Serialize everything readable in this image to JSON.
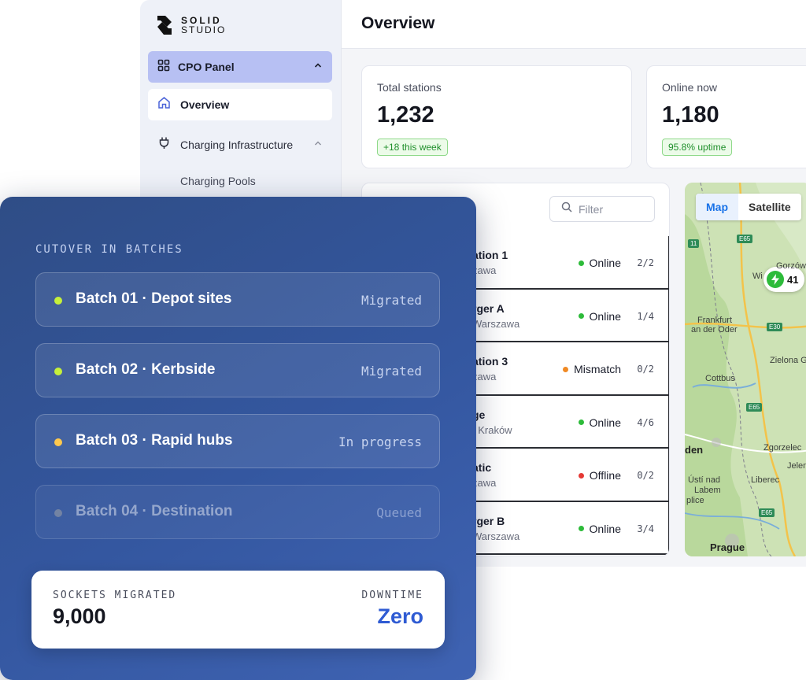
{
  "brand": {
    "line1": "SOLID",
    "line2": "STUDIO"
  },
  "sidebar": {
    "group": {
      "label": "CPO Panel",
      "icon": "grid-icon",
      "chevron": "chevron-up-icon"
    },
    "items": [
      {
        "label": "Overview",
        "icon": "home-icon",
        "active": true
      },
      {
        "label": "Charging Infrastructure",
        "icon": "plug-icon",
        "expanded": true
      }
    ],
    "subitems": [
      {
        "label": "Charging Pools"
      }
    ]
  },
  "header": {
    "title": "Overview"
  },
  "stats": [
    {
      "label": "Total stations",
      "value": "1,232",
      "badge": "+18 this week"
    },
    {
      "label": "Online now",
      "value": "1,180",
      "badge": "95.8% uptime"
    }
  ],
  "stations": {
    "filter_placeholder": "Filter",
    "rows": [
      {
        "name": "ation 1",
        "location": "zawa",
        "status": "Online",
        "status_color": "#2dbb3a",
        "count": "2/2"
      },
      {
        "name": "rger A",
        "location": "Warszawa",
        "status": "Online",
        "status_color": "#2dbb3a",
        "count": "1/4"
      },
      {
        "name": "ation 3",
        "location": "zawa",
        "status": "Mismatch",
        "status_color": "#f08a24",
        "count": "0/2"
      },
      {
        "name": "ge",
        "location": ", Kraków",
        "status": "Online",
        "status_color": "#2dbb3a",
        "count": "4/6"
      },
      {
        "name": "atic",
        "location": "zawa",
        "status": "Offline",
        "status_color": "#e53935",
        "count": "0/2"
      },
      {
        "name": "rger B",
        "location": "Warszawa",
        "status": "Online",
        "status_color": "#2dbb3a",
        "count": "3/4"
      }
    ]
  },
  "map": {
    "tabs": [
      {
        "label": "Map",
        "active": true
      },
      {
        "label": "Satellite",
        "active": false
      }
    ],
    "pin_count": "41",
    "labels": [
      {
        "text": "Gorzów"
      },
      {
        "text": "Wi"
      },
      {
        "text": "Frankfurt"
      },
      {
        "text": "an der Oder"
      },
      {
        "text": "Zielona G"
      },
      {
        "text": "Cottbus"
      },
      {
        "text": "den"
      },
      {
        "text": "Zgorzelec"
      },
      {
        "text": "Jelen"
      },
      {
        "text": "Ústí nad"
      },
      {
        "text": "Labem"
      },
      {
        "text": "Liberec"
      },
      {
        "text": "plice"
      },
      {
        "text": "Prague"
      }
    ],
    "road_shields": [
      "E65",
      "E30",
      "11",
      "E65",
      "E65"
    ]
  },
  "cutover": {
    "heading": "CUTOVER IN BATCHES",
    "batches": [
      {
        "name": "Batch 01 · Depot sites",
        "state": "Migrated",
        "dot_color": "#c6f03a"
      },
      {
        "name": "Batch 02 · Kerbside",
        "state": "Migrated",
        "dot_color": "#c6f03a"
      },
      {
        "name": "Batch 03 · Rapid hubs",
        "state": "In progress",
        "dot_color": "#ffc94d"
      },
      {
        "name": "Batch 04 · Destination",
        "state": "Queued",
        "dot_color": "#7383a3"
      }
    ],
    "summary": {
      "left_label": "SOCKETS MIGRATED",
      "left_value": "9,000",
      "right_label": "DOWNTIME",
      "right_value": "Zero"
    }
  },
  "colors": {
    "accent": "#2f5bd3",
    "panel": "#3457a0",
    "nav_active_group": "#b7c0f3"
  }
}
